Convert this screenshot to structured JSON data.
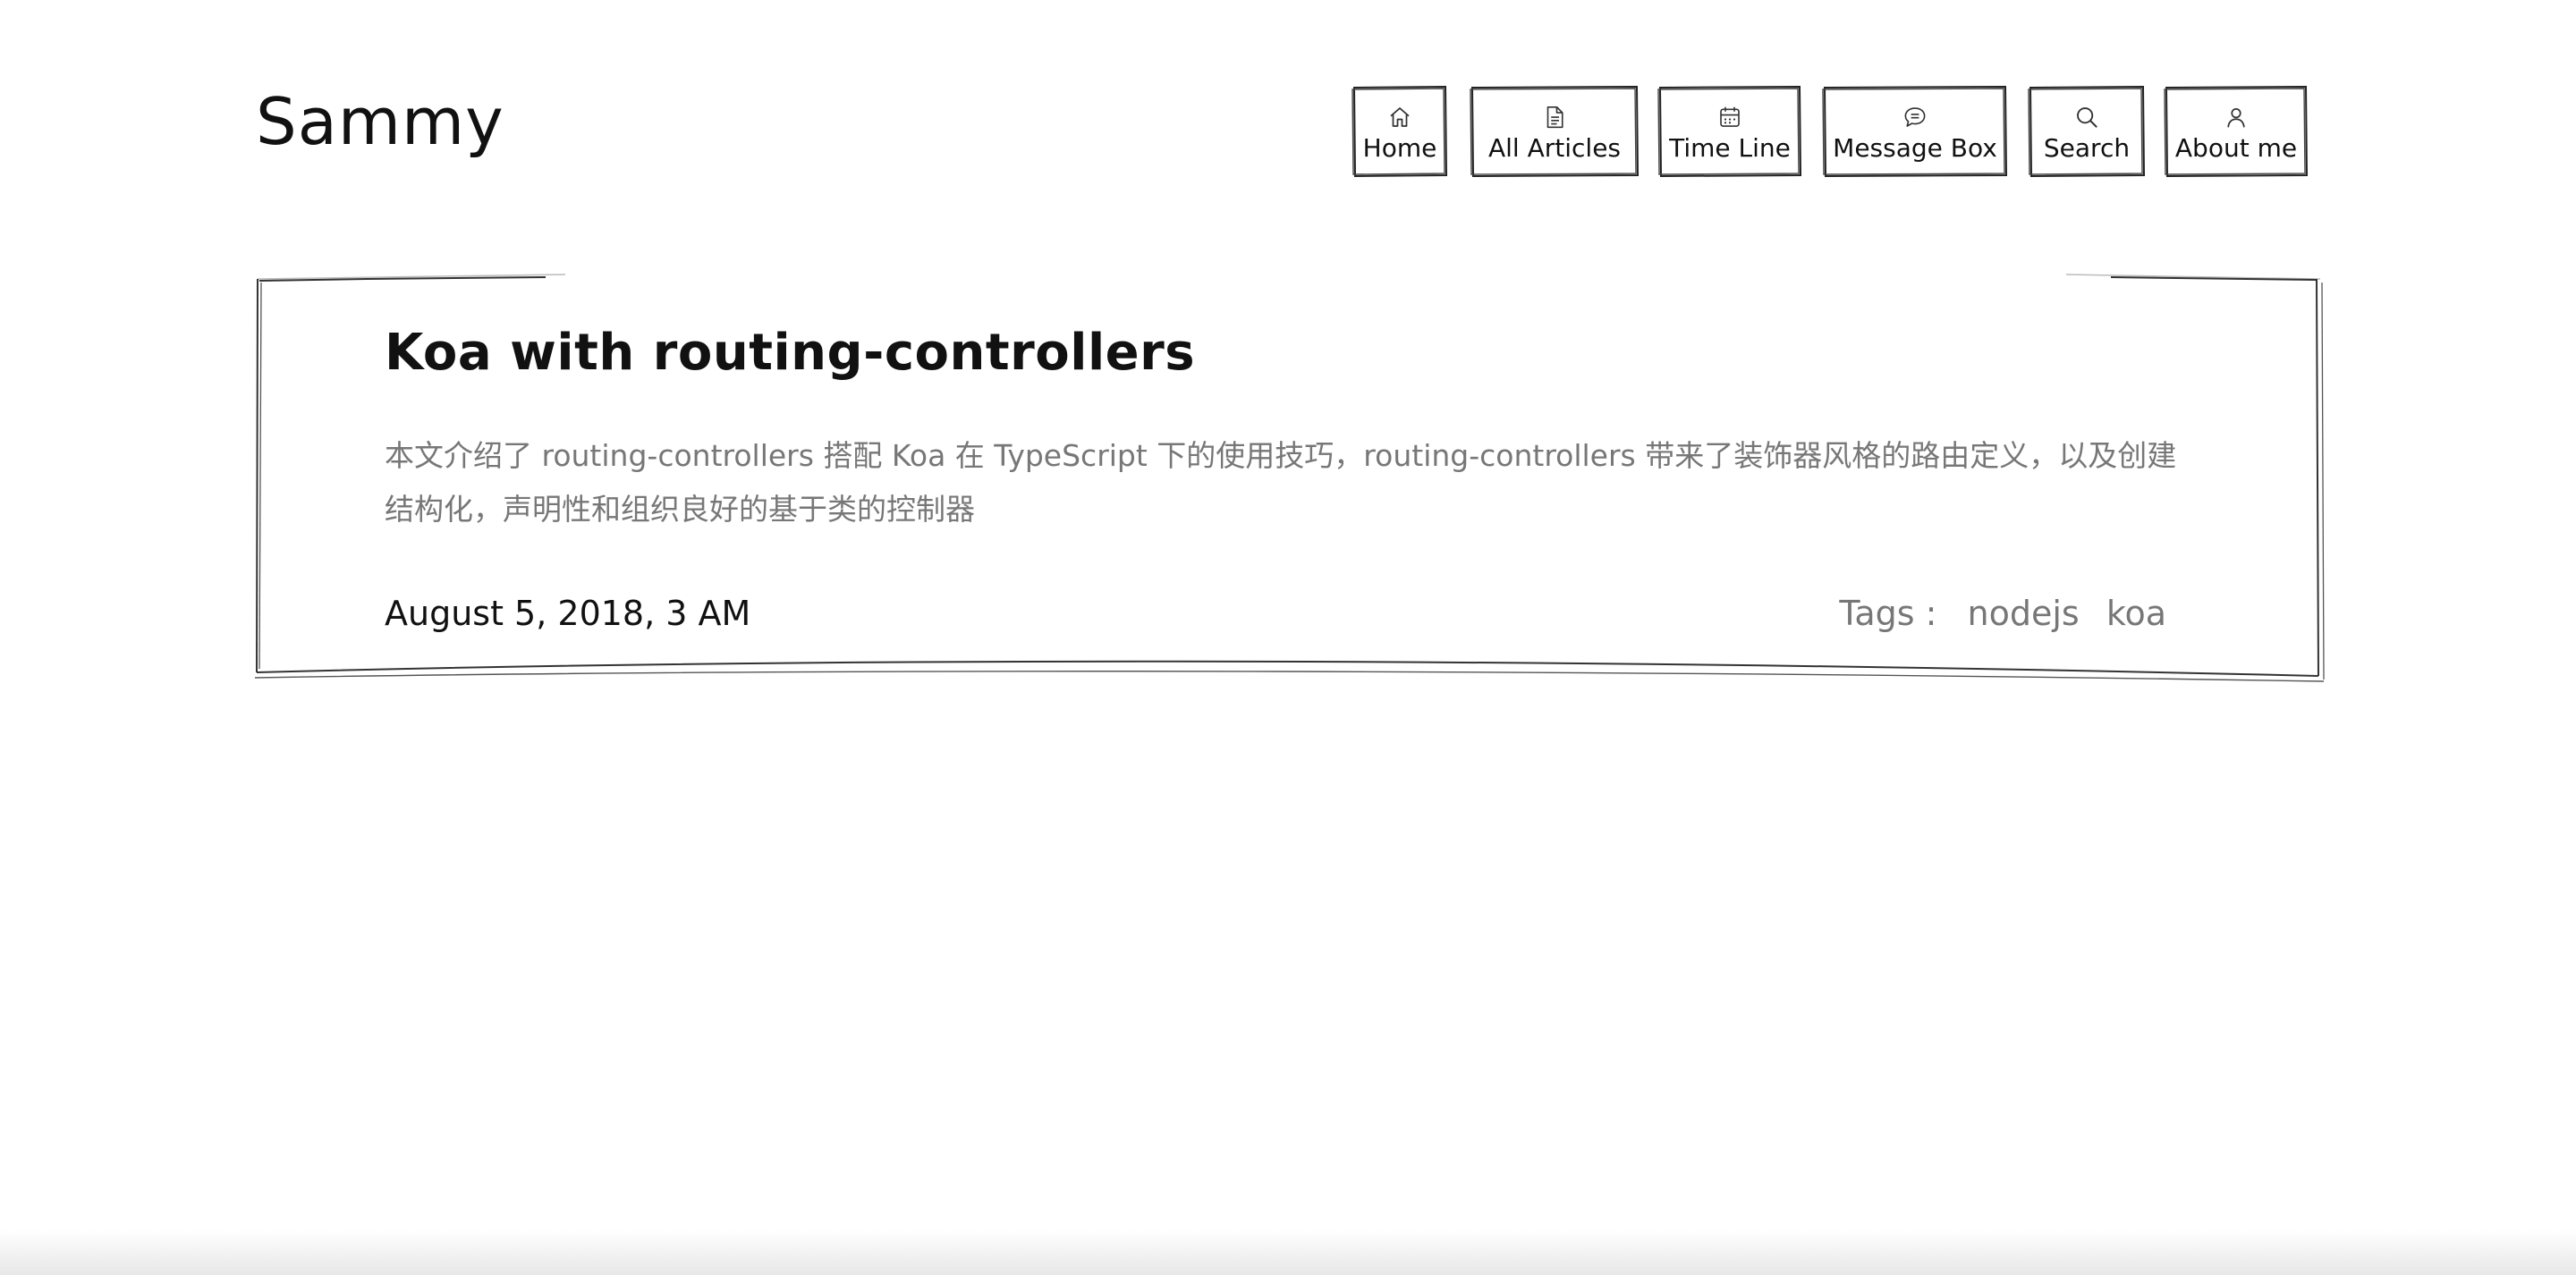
{
  "site": {
    "title": "Sammy"
  },
  "nav": {
    "items": [
      {
        "label": "Home",
        "icon": "home-icon"
      },
      {
        "label": "All Articles",
        "icon": "document-icon"
      },
      {
        "label": "Time Line",
        "icon": "calendar-icon"
      },
      {
        "label": "Message Box",
        "icon": "message-icon"
      },
      {
        "label": "Search",
        "icon": "search-icon"
      },
      {
        "label": "About me",
        "icon": "user-icon"
      }
    ]
  },
  "article": {
    "title": "Koa with routing-controllers",
    "summary": "本文介绍了 routing-controllers 搭配 Koa 在 TypeScript 下的使用技巧，routing-controllers 带来了装饰器风格的路由定义，以及创建结构化，声明性和组织良好的基于类的控制器",
    "date": "August 5, 2018, 3 AM",
    "tags_label": "Tags :",
    "tags": [
      "nodejs",
      "koa"
    ]
  },
  "colors": {
    "text": "#111111",
    "muted": "#777777",
    "background": "#ffffff"
  }
}
